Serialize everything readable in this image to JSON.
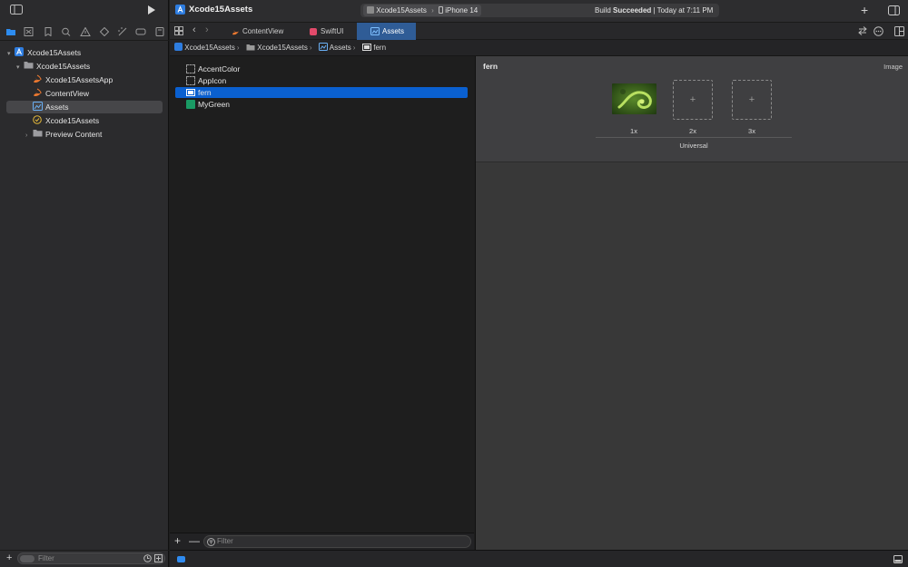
{
  "sidebar": {
    "tree": [
      {
        "label": "Xcode15Assets",
        "icon": "xcode-project-icon",
        "indent": 0,
        "disclosure": "▾",
        "selected": false
      },
      {
        "label": "Xcode15Assets",
        "icon": "folder-icon",
        "indent": 1,
        "disclosure": "▾",
        "selected": false
      },
      {
        "label": "Xcode15AssetsApp",
        "icon": "swift-file-icon",
        "indent": 2,
        "disclosure": "",
        "selected": false
      },
      {
        "label": "ContentView",
        "icon": "swift-file-icon",
        "indent": 2,
        "disclosure": "",
        "selected": false
      },
      {
        "label": "Assets",
        "icon": "asset-catalog-icon",
        "indent": 2,
        "disclosure": "",
        "selected": true
      },
      {
        "label": "Xcode15Assets",
        "icon": "entitlements-icon",
        "indent": 2,
        "disclosure": "",
        "selected": false
      },
      {
        "label": "Preview Content",
        "icon": "folder-icon",
        "indent": 2,
        "disclosure": "›",
        "selected": false
      }
    ],
    "filter_placeholder": "Filter"
  },
  "toolbar": {
    "project_title": "Xcode15Assets",
    "scheme": "Xcode15Assets",
    "destination": "iPhone 14",
    "status_prefix": "Build",
    "status_bold": "Succeeded",
    "status_time": "| Today at 7:11 PM"
  },
  "tabs": [
    {
      "label": "ContentView",
      "icon": "swift-file-icon",
      "active": false
    },
    {
      "label": "SwiftUI",
      "icon": "swiftui-icon",
      "active": false
    },
    {
      "label": "Assets",
      "icon": "asset-catalog-icon",
      "active": true
    }
  ],
  "breadcrumb": [
    {
      "label": "Xcode15Assets",
      "icon": "xcode-project-icon"
    },
    {
      "label": "Xcode15Assets",
      "icon": "folder-icon"
    },
    {
      "label": "Assets",
      "icon": "asset-catalog-icon"
    },
    {
      "label": "fern",
      "icon": "image-set-icon"
    }
  ],
  "assets": [
    {
      "label": "AccentColor",
      "type": "color-empty",
      "selected": false
    },
    {
      "label": "AppIcon",
      "type": "appicon",
      "selected": false
    },
    {
      "label": "fern",
      "type": "image",
      "selected": true
    },
    {
      "label": "MyGreen",
      "type": "color",
      "color": "#1a9a64",
      "selected": false
    }
  ],
  "asset_filter_placeholder": "Filter",
  "detail": {
    "name": "fern",
    "kind": "Image",
    "slots": [
      {
        "label": "1x",
        "filled": true
      },
      {
        "label": "2x",
        "filled": false,
        "plus": "+"
      },
      {
        "label": "3x",
        "filled": false,
        "plus": "+"
      }
    ],
    "group_label": "Universal"
  },
  "colors": {
    "accent": "#0a60d0",
    "selected_tab": "#2f5c96",
    "my_green": "#1a9a64"
  }
}
